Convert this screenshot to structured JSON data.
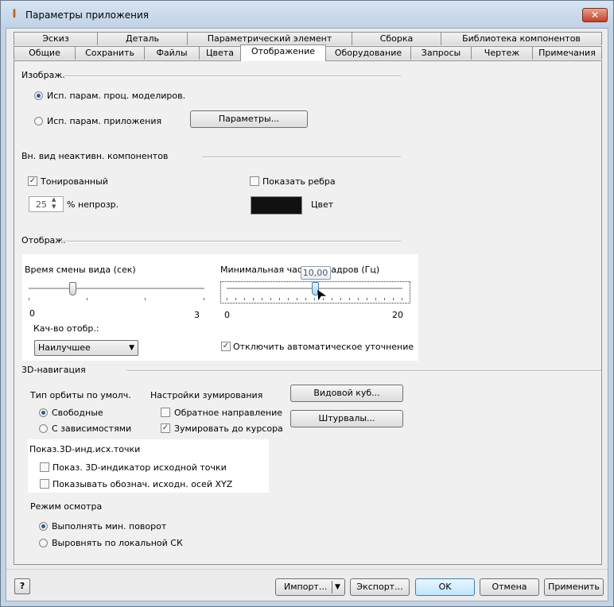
{
  "window": {
    "title": "Параметры приложения",
    "close_glyph": "✕",
    "icon_glyph": "I"
  },
  "tabs_row1": [
    "Эскиз",
    "Деталь",
    "Параметрический элемент",
    "Сборка",
    "Библиотека компонентов"
  ],
  "tabs_row2": [
    "Общие",
    "Сохранить",
    "Файлы",
    "Цвета",
    "Отображение",
    "Оборудование",
    "Запросы",
    "Чертеж",
    "Примечания"
  ],
  "active_tab": "Отображение",
  "appearance": {
    "title": "Изображ.",
    "radio_model": "Исп. парам. проц. моделиров.",
    "radio_app": "Исп. парам. приложения",
    "settings_button": "Параметры..."
  },
  "inactive": {
    "title": "Вн. вид неактивн. компонентов",
    "shaded_label": "Тонированный",
    "shaded_checked": true,
    "edges_label": "Показать ребра",
    "edges_checked": false,
    "opacity_value": "25",
    "opacity_label": "% непрозр.",
    "color_label": "Цвет",
    "color_value": "#111111"
  },
  "display": {
    "title": "Отображ.",
    "view_time_label": "Время смены вида (сек)",
    "view_time_min": "0",
    "view_time_max": "3",
    "view_time_value": 0.75,
    "min_fps_label": "Минимальная частота кадров (Гц)",
    "min_fps_min": "0",
    "min_fps_max": "20",
    "min_fps_value": 10,
    "min_fps_tooltip": "10,00",
    "quality_label": "Кач-во отобр.:",
    "quality_value": "Наилучшее",
    "disable_refine_label": "Отключить автоматическое уточнение",
    "disable_refine_checked": true
  },
  "navigation": {
    "title": "3D-навигация",
    "orbit_title": "Тип орбиты по умолч.",
    "orbit_free": "Свободные",
    "orbit_constrained": "С зависимостями",
    "zoom_title": "Настройки зумирования",
    "zoom_reverse": "Обратное направление",
    "zoom_reverse_checked": false,
    "zoom_cursor": "Зумировать до курсора",
    "zoom_cursor_checked": true,
    "viewcube_button": "Видовой куб...",
    "steering_button": "Штурвалы...",
    "origin_title": "Показ.3D-инд.исх.точки",
    "origin_indicator": "Показ. 3D-индикатор исходной точки",
    "origin_axes": "Показывать обознач. исходн. осей XYZ",
    "inspect_title": "Режим осмотра",
    "inspect_min_rotate": "Выполнять мин. поворот",
    "inspect_align_local": "Выровнять по локальной СК"
  },
  "footer": {
    "help": "?",
    "import": "Импорт...",
    "export": "Экспорт...",
    "ok": "OK",
    "cancel": "Отмена",
    "apply": "Применить"
  }
}
